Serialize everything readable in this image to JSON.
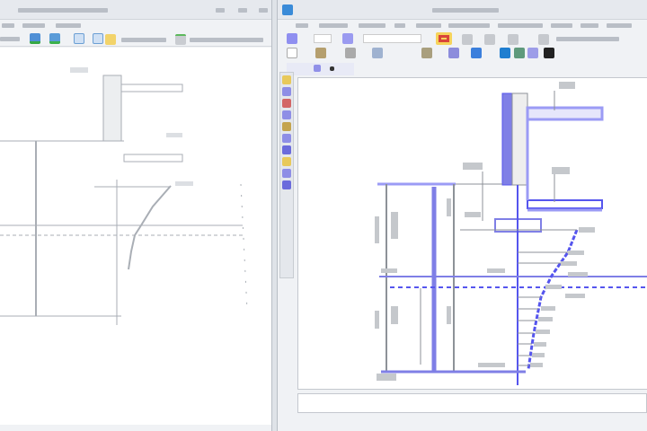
{
  "left_window": {
    "title": "",
    "toolbar_icons": [
      "layout-icon",
      "layout-green-icon",
      "window-icon",
      "window-icon",
      "folder-icon",
      "tool-icon"
    ],
    "drawing_color": "#a9aeb5"
  },
  "right_window": {
    "title": "",
    "app_icon": "app-logo-icon",
    "toolbar_icons": [
      "select-icon",
      "color-icon",
      "grid-icon",
      "snap-icon",
      "layer-icon",
      "view-icon",
      "zoom-icon"
    ],
    "vertical_tools": [
      "point-icon",
      "line-icon",
      "circle-icon",
      "arc-icon",
      "dimension-icon",
      "hatch-icon",
      "text-icon",
      "measure-icon",
      "edit-icon",
      "select-icon"
    ],
    "accent_color": "#5555ee",
    "highlight_color": "#9b9bf5",
    "drawing_color": "#8d9298"
  }
}
